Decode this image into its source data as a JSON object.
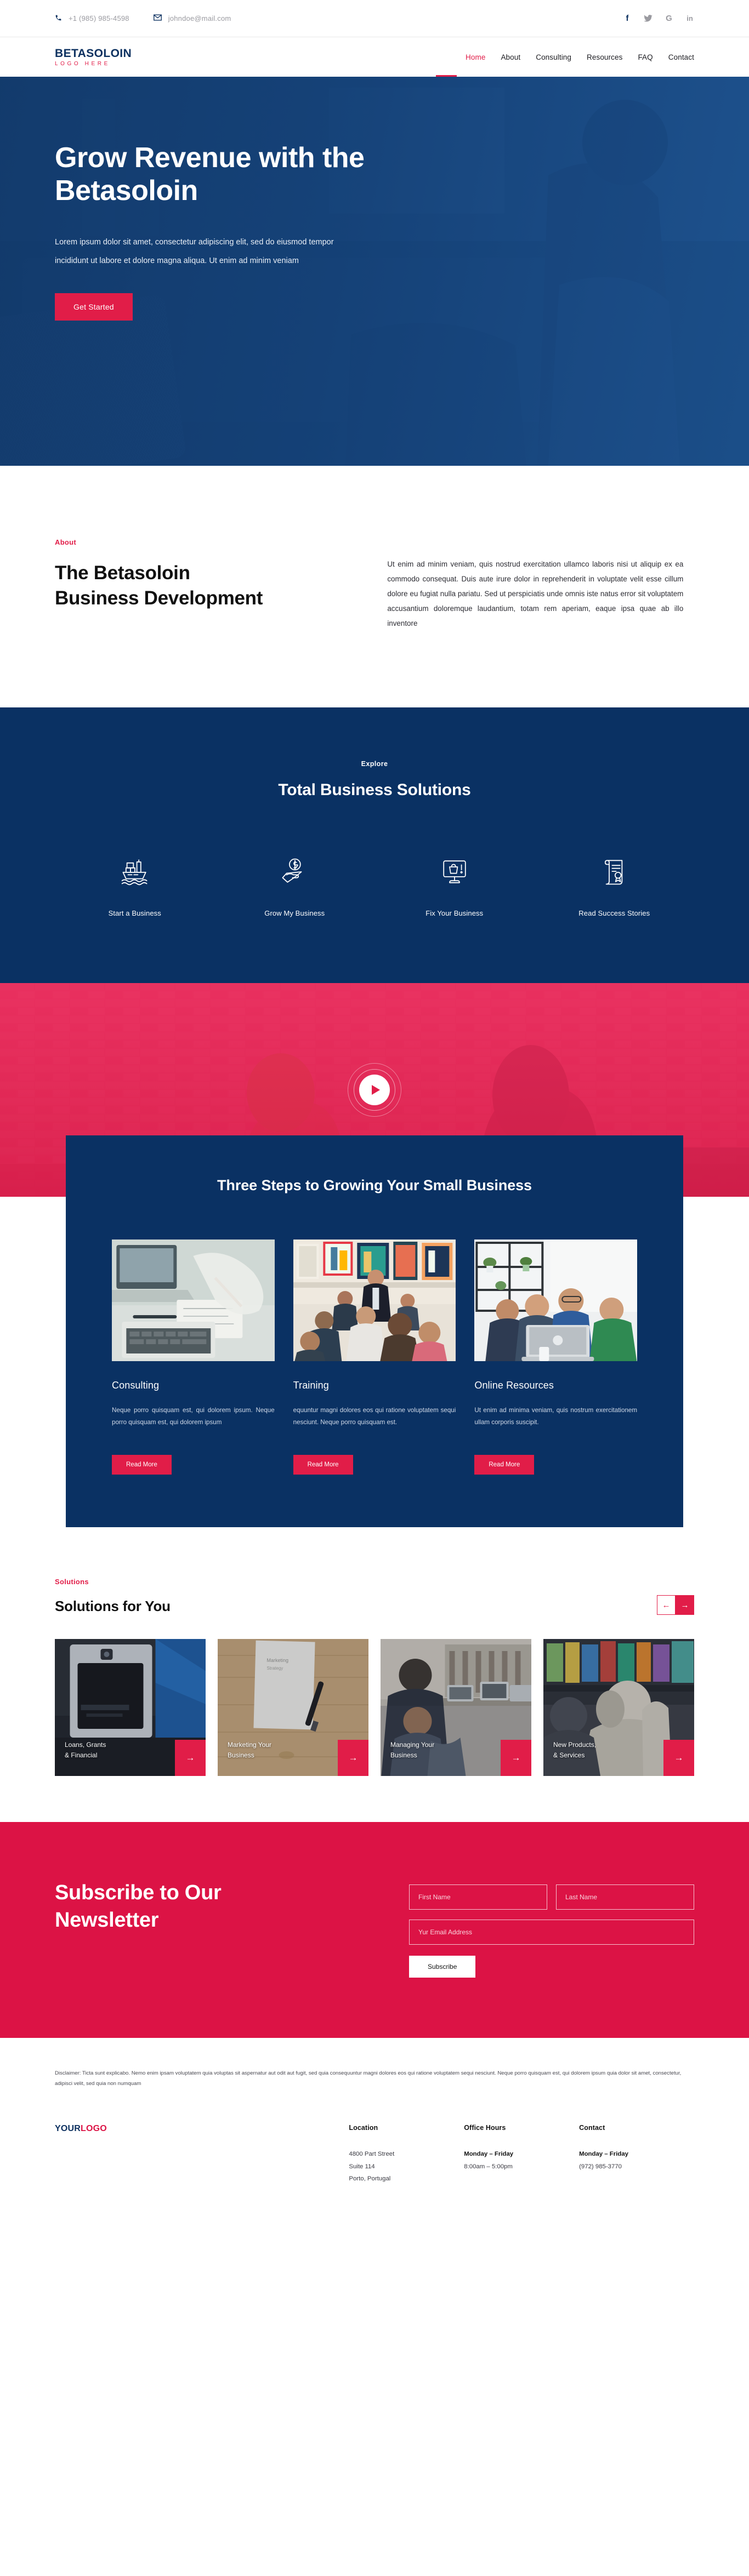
{
  "topbar": {
    "phone": "+1 (985) 985-4598",
    "email": "johndoe@mail.com",
    "phone_icon": "phone-icon",
    "email_icon": "envelope-icon",
    "social": [
      {
        "name": "facebook-icon",
        "glyph": "f"
      },
      {
        "name": "twitter-icon",
        "glyph": "ᴠ"
      },
      {
        "name": "google-icon",
        "glyph": "G"
      },
      {
        "name": "linkedin-icon",
        "glyph": "in"
      }
    ]
  },
  "brand": {
    "name": "BETASOLOIN",
    "tagline": "LOGO HERE",
    "navy": "#0d3160",
    "crimson": "#e11d48"
  },
  "nav": {
    "items": [
      {
        "label": "Home",
        "active": true
      },
      {
        "label": "About",
        "active": false
      },
      {
        "label": "Consulting",
        "active": false
      },
      {
        "label": "Resources",
        "active": false
      },
      {
        "label": "FAQ",
        "active": false
      },
      {
        "label": "Contact",
        "active": false
      }
    ]
  },
  "hero": {
    "title": "Grow Revenue with the Betasoloin",
    "paragraph": "Lorem ipsum dolor sit amet, consectetur adipiscing elit, sed do eiusmod tempor incididunt ut labore et dolore magna aliqua. Ut enim ad minim veniam",
    "cta": "Get Started"
  },
  "about": {
    "eyebrow": "About",
    "heading": "The Betasoloin Business Development",
    "body": "Ut enim ad minim veniam, quis nostrud exercitation ullamco laboris nisi ut aliquip ex ea commodo consequat. Duis aute irure dolor in reprehenderit in voluptate velit esse cillum dolore eu fugiat nulla pariatu. Sed ut perspiciatis unde omnis iste natus error sit voluptatem accusantium doloremque laudantium, totam rem aperiam, eaque ipsa quae ab illo inventore"
  },
  "solutions_band": {
    "eyebrow": "Explore",
    "heading": "Total Business Solutions",
    "features": [
      {
        "label": "Start a Business",
        "icon": "cargo-ship-icon"
      },
      {
        "label": "Grow My Business",
        "icon": "hand-dollar-coin-icon"
      },
      {
        "label": "Fix Your Business",
        "icon": "monitor-basket-icon"
      },
      {
        "label": "Read Success Stories",
        "icon": "certificate-scroll-icon"
      }
    ]
  },
  "video": {
    "play_icon": "play-icon"
  },
  "steps": {
    "heading": "Three Steps to Growing Your Small Business",
    "cards": [
      {
        "title": "Consulting",
        "body": "Neque porro quisquam est, qui dolorem ipsum. Neque porro quisquam est, qui dolorem ipsum",
        "cta": "Read More",
        "image": "laptop-notes-photo"
      },
      {
        "title": "Training",
        "body": "equuntur magni dolores eos qui ratione voluptatem sequi nesciunt. Neque porro quisquam est.",
        "cta": "Read More",
        "image": "group-workshop-photo"
      },
      {
        "title": "Online Resources",
        "body": "Ut enim ad minima veniam, quis nostrum exercitationem ullam corporis suscipit.",
        "cta": "Read More",
        "image": "team-laptop-photo"
      }
    ]
  },
  "sfy": {
    "eyebrow": "Solutions",
    "heading": "Solutions for You",
    "prev_icon": "arrow-left-icon",
    "next_icon": "arrow-right-icon",
    "prev_glyph": "←",
    "next_glyph": "→",
    "cards": [
      {
        "label": "Loans, Grants\n& Financial",
        "go_icon": "arrow-right-icon"
      },
      {
        "label": "Marketing Your\nBusiness",
        "go_icon": "arrow-right-icon"
      },
      {
        "label": "Managing Your\nBusiness",
        "go_icon": "arrow-right-icon"
      },
      {
        "label": "New Products,\n& Services",
        "go_icon": "arrow-right-icon"
      }
    ]
  },
  "newsletter": {
    "heading": "Subscribe to Our Newsletter",
    "first_name_placeholder": "First Name",
    "last_name_placeholder": "Last Name",
    "email_placeholder": "Yur Email Address",
    "first_name_value": "",
    "last_name_value": "",
    "email_value": "",
    "submit": "Subscribe"
  },
  "footer": {
    "disclaimer": "Disclaimer:  Ticta sunt explicabo. Nemo enim ipsam voluptatem quia voluptas sit aspernatur aut odit aut fugit, sed quia consequuntur magni dolores eos qui ratione voluptatem sequi nesciunt. Neque porro quisquam est, qui dolorem ipsum quia dolor sit amet, consectetur, adipisci velit, sed quia non numquam",
    "logo_a": "YOUR",
    "logo_b": "LOGO",
    "location": {
      "title": "Location",
      "l1": "4800 Part Street",
      "l2": "Suite 114",
      "l3": "Porto, Portugal"
    },
    "hours": {
      "title": "Office Hours",
      "l1": "Monday – Friday",
      "l2": "8:00am – 5:00pm"
    },
    "contact": {
      "title": "Contact",
      "l1": "Monday – Friday",
      "l2": "(972) 985-3770"
    }
  }
}
